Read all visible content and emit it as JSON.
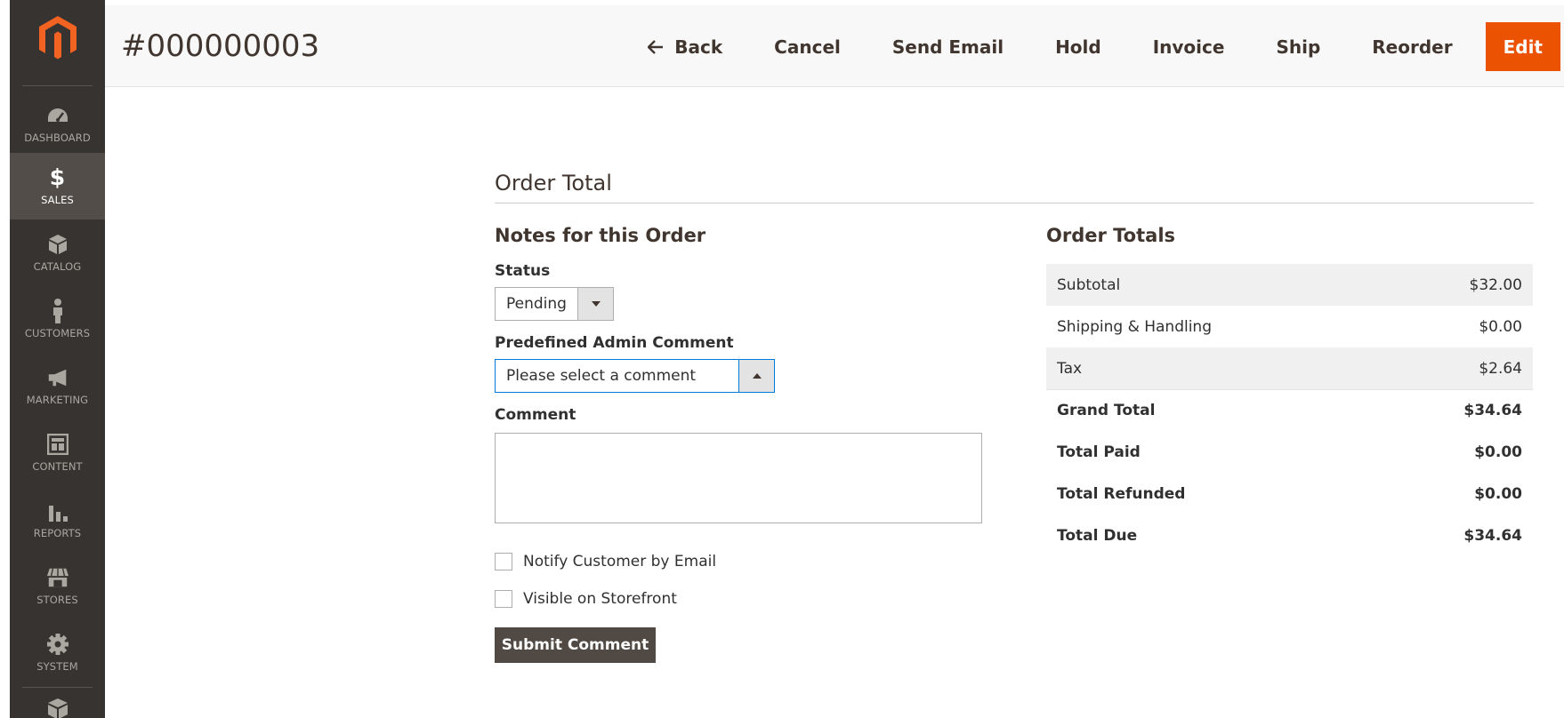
{
  "header": {
    "order_id": "#000000003",
    "actions": {
      "back": "Back",
      "cancel": "Cancel",
      "send_email": "Send Email",
      "hold": "Hold",
      "invoice": "Invoice",
      "ship": "Ship",
      "reorder": "Reorder",
      "edit": "Edit"
    },
    "accent_color": "#eb5202"
  },
  "sidebar": {
    "logo_icon": "magento-logo-icon",
    "items": [
      {
        "label": "DASHBOARD",
        "icon": "speedometer-icon"
      },
      {
        "label": "SALES",
        "icon": "dollar-icon",
        "glyph": "$",
        "active": true
      },
      {
        "label": "CATALOG",
        "icon": "box-icon"
      },
      {
        "label": "CUSTOMERS",
        "icon": "person-icon"
      },
      {
        "label": "MARKETING",
        "icon": "megaphone-icon"
      },
      {
        "label": "CONTENT",
        "icon": "layout-icon"
      },
      {
        "label": "REPORTS",
        "icon": "bar-chart-icon"
      },
      {
        "label": "STORES",
        "icon": "storefront-icon"
      },
      {
        "label": "SYSTEM",
        "icon": "gear-icon"
      }
    ]
  },
  "section": {
    "title": "Order Total"
  },
  "notes": {
    "title": "Notes for this Order",
    "status_label": "Status",
    "status_value": "Pending",
    "predefined_label": "Predefined Admin Comment",
    "predefined_value": "Please select a comment",
    "comment_label": "Comment",
    "comment_value": "",
    "notify_label": "Notify Customer by Email",
    "visible_label": "Visible on Storefront",
    "submit_label": "Submit Comment"
  },
  "totals": {
    "title": "Order Totals",
    "rows": [
      {
        "label": "Subtotal",
        "value": "$32.00"
      },
      {
        "label": "Shipping & Handling",
        "value": "$0.00"
      },
      {
        "label": "Tax",
        "value": "$2.64"
      },
      {
        "label": "Grand Total",
        "value": "$34.64"
      },
      {
        "label": "Total Paid",
        "value": "$0.00"
      },
      {
        "label": "Total Refunded",
        "value": "$0.00"
      },
      {
        "label": "Total Due",
        "value": "$34.64"
      }
    ]
  }
}
